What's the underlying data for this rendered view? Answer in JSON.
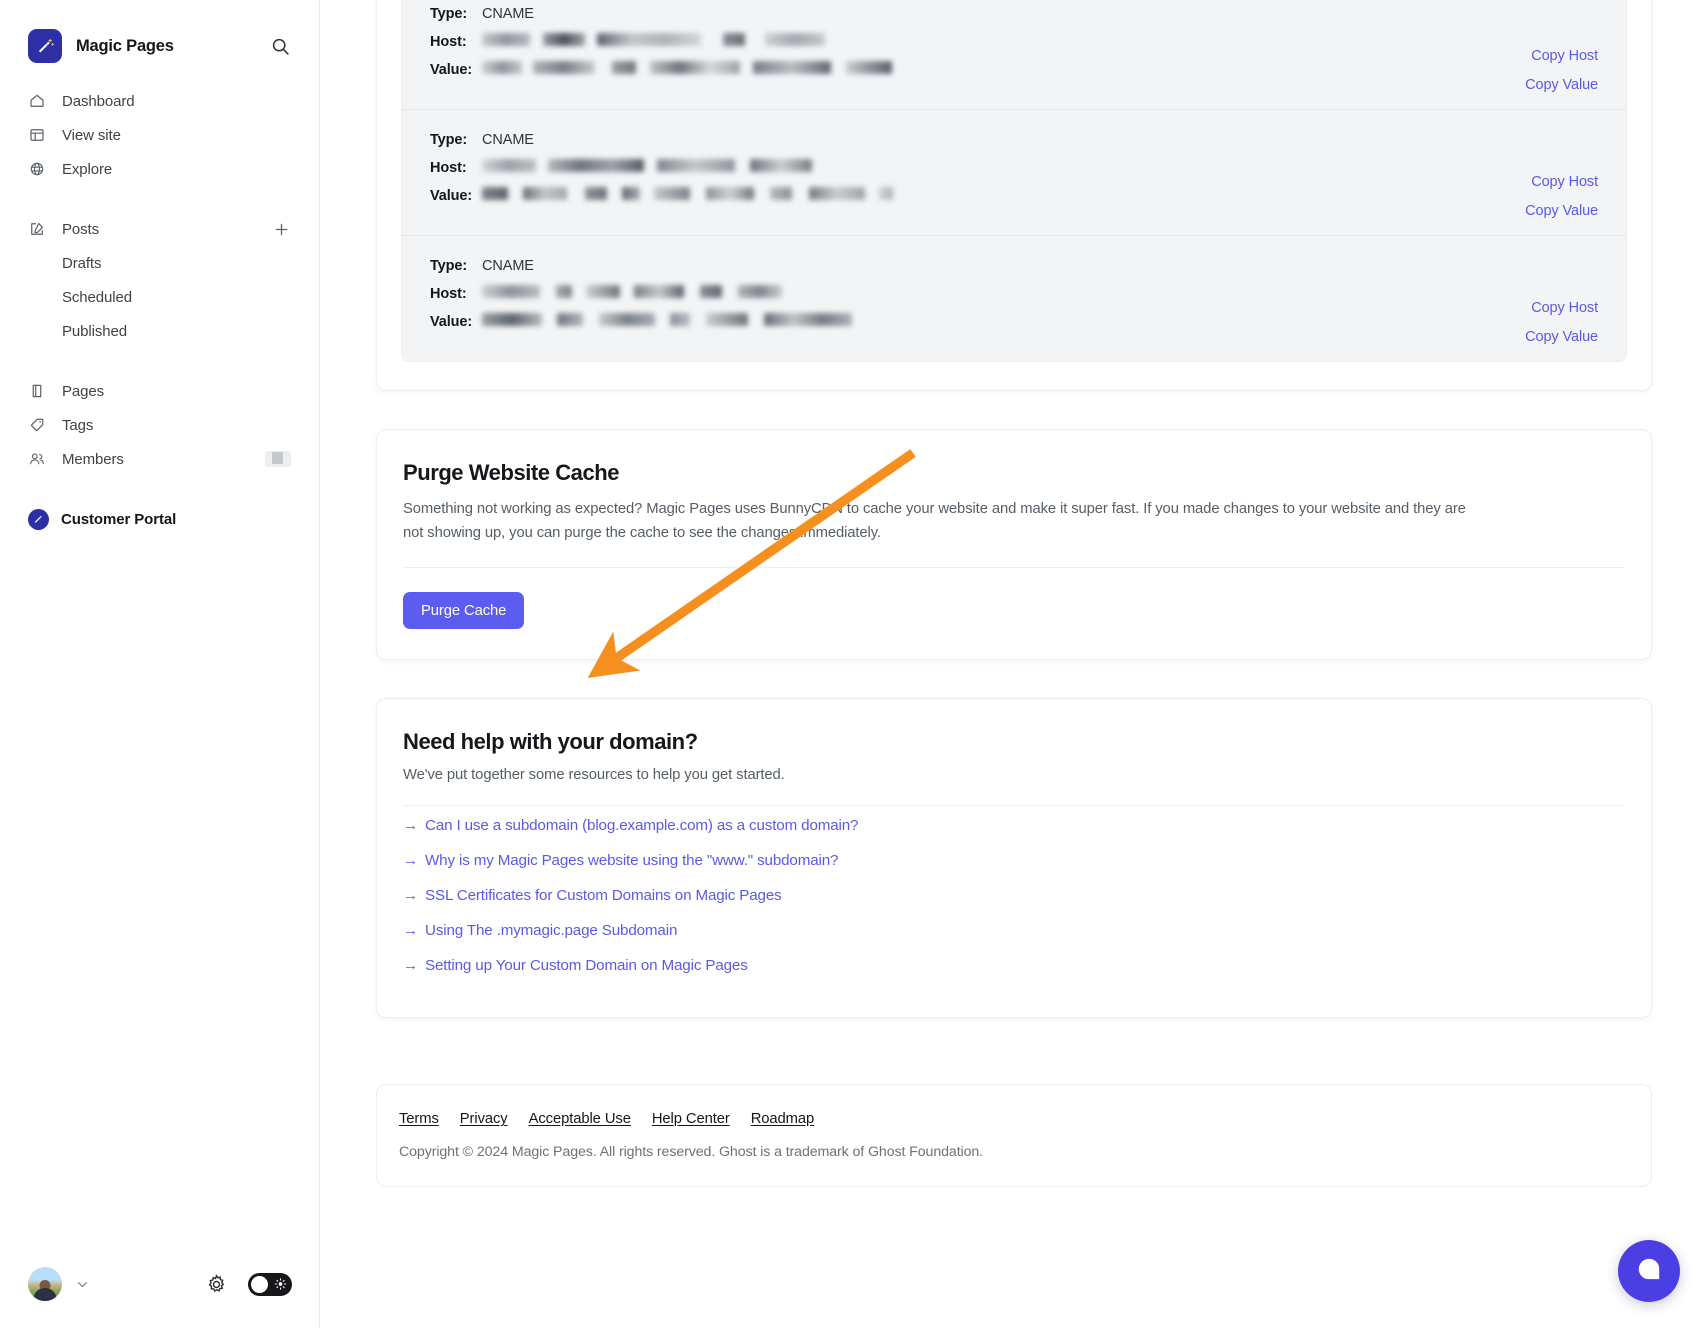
{
  "sidebar": {
    "brand": {
      "title": "Magic Pages",
      "logo_icon": "magic-wand-icon",
      "search_icon": "search-icon"
    },
    "groups": [
      {
        "items": [
          {
            "label": "Dashboard",
            "icon": "home-icon"
          },
          {
            "label": "View site",
            "icon": "layout-icon"
          },
          {
            "label": "Explore",
            "icon": "globe-icon"
          }
        ]
      },
      {
        "items": [
          {
            "label": "Posts",
            "icon": "edit-icon",
            "trailing": "plus-icon"
          },
          {
            "label": "Drafts",
            "icon": "",
            "sub": true
          },
          {
            "label": "Scheduled",
            "icon": "",
            "sub": true
          },
          {
            "label": "Published",
            "icon": "",
            "sub": true
          }
        ]
      },
      {
        "items": [
          {
            "label": "Pages",
            "icon": "book-icon"
          },
          {
            "label": "Tags",
            "icon": "tag-icon"
          },
          {
            "label": "Members",
            "icon": "members-icon",
            "trailing": "badge"
          }
        ]
      }
    ],
    "portal": {
      "label": "Customer Portal",
      "icon": "magic-wand-icon"
    },
    "bottom": {
      "avatar": "user-avatar",
      "chevron": "chevron-down-icon",
      "gear": "gear-icon",
      "mode_toggle": "dark-mode-toggle"
    }
  },
  "dns": {
    "records": [
      {
        "type_label": "Type:",
        "type_value": "CNAME",
        "host_label": "Host:",
        "host_value": "",
        "value_label": "Value:",
        "value_value": "",
        "copy_host": "Copy Host",
        "copy_value": "Copy Value"
      },
      {
        "type_label": "Type:",
        "type_value": "CNAME",
        "host_label": "Host:",
        "host_value": "",
        "value_label": "Value:",
        "value_value": "",
        "copy_host": "Copy Host",
        "copy_value": "Copy Value"
      },
      {
        "type_label": "Type:",
        "type_value": "CNAME",
        "host_label": "Host:",
        "host_value": "",
        "value_label": "Value:",
        "value_value": "",
        "copy_host": "Copy Host",
        "copy_value": "Copy Value"
      }
    ]
  },
  "purge": {
    "title": "Purge Website Cache",
    "body": "Something not working as expected? Magic Pages uses BunnyCDN to cache your website and make it super fast. If you made changes to your website and they are not showing up, you can purge the cache to see the changes immediately.",
    "button_label": "Purge Cache"
  },
  "help": {
    "title": "Need help with your domain?",
    "subtitle": "We've put together some resources to help you get started.",
    "links": [
      "Can I use a subdomain (blog.example.com) as a custom domain?",
      "Why is my Magic Pages website using the \"www.\" subdomain?",
      "SSL Certificates for Custom Domains on Magic Pages",
      "Using The .mymagic.page Subdomain",
      "Setting up Your Custom Domain on Magic Pages"
    ],
    "arrow_glyph": "→"
  },
  "footer": {
    "links": [
      "Terms",
      "Privacy",
      "Acceptable Use",
      "Help Center",
      "Roadmap"
    ],
    "copyright": "Copyright © 2024 Magic Pages. All rights reserved. Ghost is a trademark of Ghost Foundation."
  },
  "chat": {
    "icon": "chat-bubble-icon"
  },
  "annotation": {
    "arrow_color": "#F5901E"
  },
  "colors": {
    "accent": "#5c5cf0",
    "link": "#5a5ae6",
    "brand": "#2d2fa6",
    "chat": "#4b3fe4"
  }
}
